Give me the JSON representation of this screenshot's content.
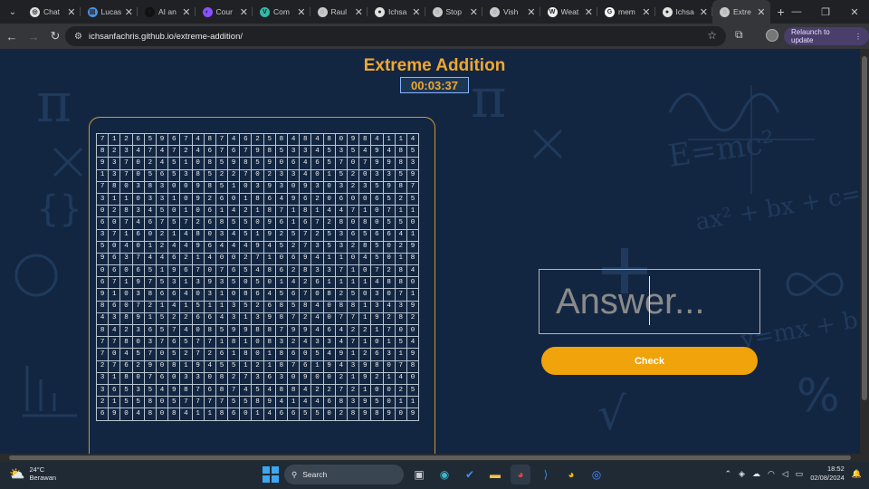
{
  "browser": {
    "tabs": [
      {
        "title": "Chat",
        "color": "#e0e0e0",
        "glyph": "◎"
      },
      {
        "title": "Lucas",
        "color": "#4a90e2",
        "glyph": "▤"
      },
      {
        "title": "AI an",
        "color": "#111111",
        "glyph": "t"
      },
      {
        "title": "Cour",
        "color": "#8a4fff",
        "glyph": "◐"
      },
      {
        "title": "Com",
        "color": "#35b8a8",
        "glyph": "V"
      },
      {
        "title": "Raul",
        "color": "#c8c8c8",
        "glyph": "◌"
      },
      {
        "title": "Ichsa",
        "color": "#e0e0e0",
        "glyph": "●"
      },
      {
        "title": "Stop",
        "color": "#c8c8c8",
        "glyph": "◌"
      },
      {
        "title": "Vish",
        "color": "#c8c8c8",
        "glyph": "◌"
      },
      {
        "title": "Weat",
        "color": "#f0f0f0",
        "glyph": "W"
      },
      {
        "title": "mem",
        "color": "#ffffff",
        "glyph": "G"
      },
      {
        "title": "Ichsa",
        "color": "#e0e0e0",
        "glyph": "●"
      },
      {
        "title": "Extre",
        "color": "#c8c8c8",
        "glyph": "◌",
        "active": true
      }
    ],
    "url": "ichsanfachris.github.io/extreme-addition/",
    "relaunch_label": "Relaunch to update"
  },
  "game": {
    "title": "Extreme Addition",
    "timer": "00:03:37",
    "answer_placeholder": "Answer...",
    "check_label": "Check",
    "grid": [
      "712659674874625848480984114",
      "823474724676798533453549485",
      "937024510859859064657079983",
      "137056538522702334015203359",
      "780383009851039309303235987",
      "311033109260186496206006525",
      "028345010614218718144710711",
      "607467572685509616728080550",
      "371602148034519257253656641",
      "504012449644494527353285029",
      "963744621400271069411045018",
      "060651967076548628337107284",
      "671975313935050142611114880",
      "910386640310864567082503071",
      "860721415113526858408813439",
      "438915226643139872407719282",
      "842365740859988799464221700",
      "778037657718108324334710154",
      "704570527261801860549126319",
      "276290819455121876194398078",
      "318076033082736309002192140",
      "365354987687454884227210025",
      "215580577775589414468395011",
      "690480841186014665502898909"
    ]
  },
  "taskbar": {
    "temp": "24°C",
    "condition": "Berawan",
    "search_label": "Search",
    "time": "18:52",
    "date": "02/08/2024"
  }
}
